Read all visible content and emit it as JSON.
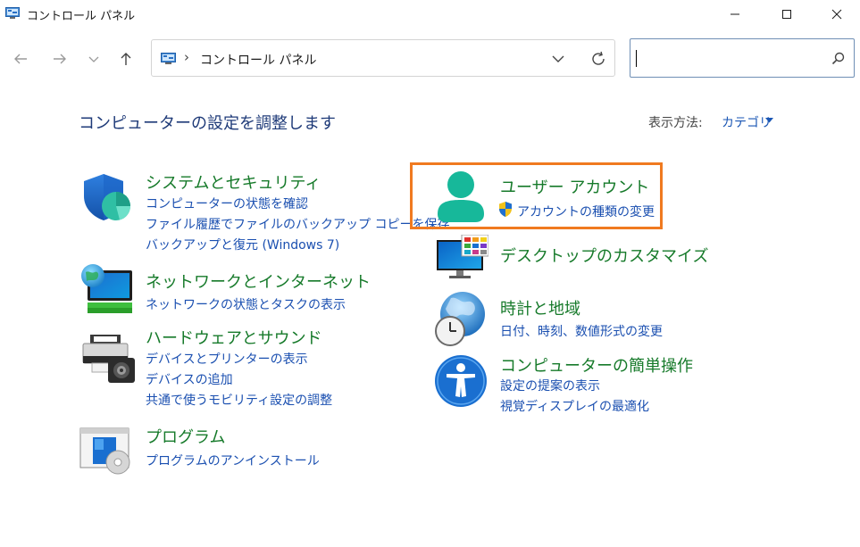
{
  "window": {
    "title": "コントロール パネル"
  },
  "address": {
    "separator": "›",
    "path": "コントロール パネル"
  },
  "search": {
    "placeholder": ""
  },
  "header": {
    "title": "コンピューターの設定を調整します",
    "view_by_label": "表示方法:",
    "view_by_value": "カテゴリ"
  },
  "categories": {
    "system": {
      "title": "システムとセキュリティ",
      "links": [
        "コンピューターの状態を確認",
        "ファイル履歴でファイルのバックアップ コピーを保存",
        "バックアップと復元 (Windows 7)"
      ]
    },
    "network": {
      "title": "ネットワークとインターネット",
      "links": [
        "ネットワークの状態とタスクの表示"
      ]
    },
    "hardware": {
      "title": "ハードウェアとサウンド",
      "links": [
        "デバイスとプリンターの表示",
        "デバイスの追加",
        "共通で使うモビリティ設定の調整"
      ]
    },
    "programs": {
      "title": "プログラム",
      "links": [
        "プログラムのアンインストール"
      ]
    },
    "user": {
      "title": "ユーザー アカウント",
      "links": [
        "アカウントの種類の変更"
      ]
    },
    "desktop": {
      "title": "デスクトップのカスタマイズ",
      "links": []
    },
    "clock": {
      "title": "時計と地域",
      "links": [
        "日付、時刻、数値形式の変更"
      ]
    },
    "ease": {
      "title": "コンピューターの簡単操作",
      "links": [
        "設定の提案の表示",
        "視覚ディスプレイの最適化"
      ]
    }
  },
  "colors": {
    "category_title": "#167a2a",
    "link": "#1a4fb0",
    "heading": "#1e3a78",
    "highlight_border": "#f07a20"
  }
}
